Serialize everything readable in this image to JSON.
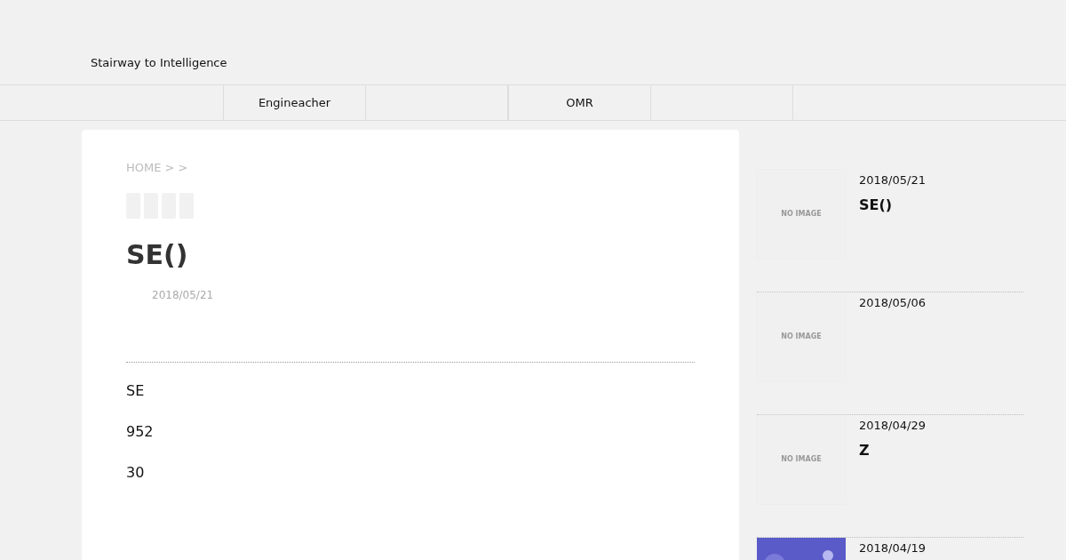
{
  "site_title": "Stairway to Intelligence",
  "nav": [
    {
      "label": "Engineacher"
    },
    {
      "label": "OMR"
    }
  ],
  "breadcrumb": "HOME > >",
  "article": {
    "title": "SE()",
    "date": "2018/05/21",
    "paragraphs": [
      "SE",
      "952",
      "30"
    ]
  },
  "sidebar": [
    {
      "thumb": {
        "kind": "placeholder",
        "text": "NO IMAGE"
      },
      "date": "2018/05/21",
      "title": "SE()"
    },
    {
      "thumb": {
        "kind": "placeholder",
        "text": "NO IMAGE"
      },
      "date": "2018/05/06"
    },
    {
      "thumb": {
        "kind": "placeholder",
        "text": "NO IMAGE"
      },
      "date": "2018/04/29",
      "title": "Z"
    },
    {
      "date": "2018/04/19"
    }
  ]
}
